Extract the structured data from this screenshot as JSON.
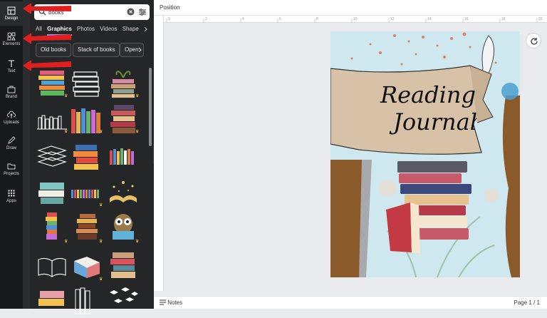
{
  "rail": [
    {
      "label": "Design",
      "icon": "layout-icon"
    },
    {
      "label": "Elements",
      "icon": "shapes-icon"
    },
    {
      "label": "Text",
      "icon": "text-icon"
    },
    {
      "label": "Brand",
      "icon": "briefcase-icon"
    },
    {
      "label": "Uploads",
      "icon": "upload-icon"
    },
    {
      "label": "Draw",
      "icon": "pen-icon"
    },
    {
      "label": "Projects",
      "icon": "folder-icon"
    },
    {
      "label": "Apps",
      "icon": "apps-icon"
    }
  ],
  "search": {
    "value": "books"
  },
  "tabs": [
    "All",
    "Graphics",
    "Photos",
    "Videos",
    "Shape"
  ],
  "chips": [
    "Old books",
    "Stack of books",
    "Open"
  ],
  "topbar": {
    "position_label": "Position"
  },
  "bottombar": {
    "notes_label": "Notes",
    "pages_label": "Page 1 / 1"
  },
  "canvas": {
    "title_line1": "Reading",
    "title_line2": "Journal"
  },
  "ruler_ticks": [
    "0",
    "2",
    "4",
    "6",
    "8",
    "10",
    "12",
    "14",
    "16",
    "18",
    "20",
    "22"
  ],
  "colors": {
    "accent": "#a78bfa",
    "arrow": "#e02020",
    "banner": "#d7c2a8"
  }
}
